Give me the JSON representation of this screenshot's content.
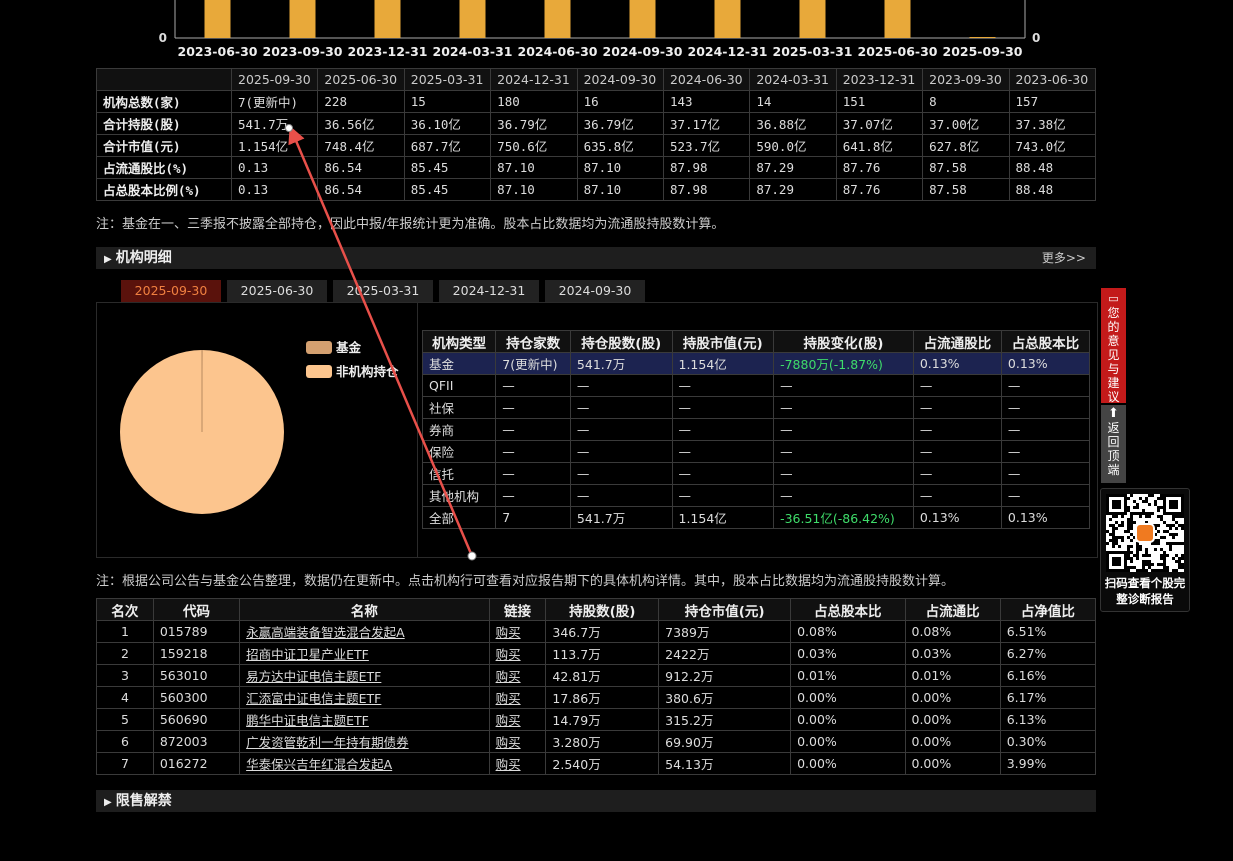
{
  "chart_data": {
    "type": "bar",
    "categories": [
      "2023-06-30",
      "2023-09-30",
      "2023-12-31",
      "2024-03-31",
      "2024-06-30",
      "2024-09-30",
      "2024-12-31",
      "2025-03-31",
      "2025-06-30",
      "2025-09-30"
    ],
    "y_left_min_label": "0",
    "y_right_min_label": "0",
    "bar_color": "#e8a93a"
  },
  "summary": {
    "headers": [
      "2025-09-30",
      "2025-06-30",
      "2025-03-31",
      "2024-12-31",
      "2024-09-30",
      "2024-06-30",
      "2024-03-31",
      "2023-12-31",
      "2023-09-30",
      "2023-06-30"
    ],
    "rows": [
      {
        "label": "机构总数(家)",
        "values": [
          "7(更新中)",
          "228",
          "15",
          "180",
          "16",
          "143",
          "14",
          "151",
          "8",
          "157"
        ]
      },
      {
        "label": "合计持股(股)",
        "values": [
          "541.7万",
          "36.56亿",
          "36.10亿",
          "36.79亿",
          "36.79亿",
          "37.17亿",
          "36.88亿",
          "37.07亿",
          "37.00亿",
          "37.38亿"
        ]
      },
      {
        "label": "合计市值(元)",
        "values": [
          "1.154亿",
          "748.4亿",
          "687.7亿",
          "750.6亿",
          "635.8亿",
          "523.7亿",
          "590.0亿",
          "641.8亿",
          "627.8亿",
          "743.0亿"
        ]
      },
      {
        "label": "占流通股比(%)",
        "values": [
          "0.13",
          "86.54",
          "85.45",
          "87.10",
          "87.10",
          "87.98",
          "87.29",
          "87.76",
          "87.58",
          "88.48"
        ]
      },
      {
        "label": "占总股本比例(%)",
        "values": [
          "0.13",
          "86.54",
          "85.45",
          "87.10",
          "87.10",
          "87.98",
          "87.29",
          "87.76",
          "87.58",
          "88.48"
        ]
      }
    ]
  },
  "note1": "注：基金在一、三季报不披露全部持仓，因此中报/年报统计更为准确。股本占比数据均为流通股持股数计算。",
  "section_detail": {
    "title": "机构明细",
    "more": "更多>>"
  },
  "tabs": [
    "2025-09-30",
    "2025-06-30",
    "2025-03-31",
    "2024-12-31",
    "2024-09-30"
  ],
  "pie": {
    "legend": [
      {
        "label": "基金",
        "color": "#d4a070"
      },
      {
        "label": "非机构持仓",
        "color": "#fcc58e"
      }
    ],
    "fund_share_pct": 0.13,
    "colors": {
      "fund": "#d4a070",
      "other": "#fcc58e"
    }
  },
  "inst_table": {
    "headers": [
      "机构类型",
      "持仓家数",
      "持仓股数(股)",
      "持股市值(元)",
      "持股变化(股)",
      "占流通股比",
      "占总股本比"
    ],
    "rows": [
      [
        "基金",
        "7(更新中)",
        "541.7万",
        "1.154亿",
        "-7880万(-1.87%)",
        "0.13%",
        "0.13%"
      ],
      [
        "QFII",
        "—",
        "—",
        "—",
        "—",
        "—",
        "—"
      ],
      [
        "社保",
        "—",
        "—",
        "—",
        "—",
        "—",
        "—"
      ],
      [
        "券商",
        "—",
        "—",
        "—",
        "—",
        "—",
        "—"
      ],
      [
        "保险",
        "—",
        "—",
        "—",
        "—",
        "—",
        "—"
      ],
      [
        "信托",
        "—",
        "—",
        "—",
        "—",
        "—",
        "—"
      ],
      [
        "其他机构",
        "—",
        "—",
        "—",
        "—",
        "—",
        "—"
      ],
      [
        "全部",
        "7",
        "541.7万",
        "1.154亿",
        "-36.51亿(-86.42%)",
        "0.13%",
        "0.13%"
      ]
    ]
  },
  "note2": "注：根据公司公告与基金公告整理，数据仍在更新中。点击机构行可查看对应报告期下的具体机构详情。其中，股本占比数据均为流通股持股数计算。",
  "rank_table": {
    "headers": [
      "名次",
      "代码",
      "名称",
      "链接",
      "持股数(股)",
      "持仓市值(元)",
      "占总股本比",
      "占流通比",
      "占净值比"
    ],
    "rows": [
      [
        "1",
        "015789",
        "永赢高端装备智选混合发起A",
        "购买",
        "346.7万",
        "7389万",
        "0.08%",
        "0.08%",
        "6.51%"
      ],
      [
        "2",
        "159218",
        "招商中证卫星产业ETF",
        "购买",
        "113.7万",
        "2422万",
        "0.03%",
        "0.03%",
        "6.27%"
      ],
      [
        "3",
        "563010",
        "易方达中证电信主题ETF",
        "购买",
        "42.81万",
        "912.2万",
        "0.01%",
        "0.01%",
        "6.16%"
      ],
      [
        "4",
        "560300",
        "汇添富中证电信主题ETF",
        "购买",
        "17.86万",
        "380.6万",
        "0.00%",
        "0.00%",
        "6.17%"
      ],
      [
        "5",
        "560690",
        "鹏华中证电信主题ETF",
        "购买",
        "14.79万",
        "315.2万",
        "0.00%",
        "0.00%",
        "6.13%"
      ],
      [
        "6",
        "872003",
        "广发资管乾利一年持有期债券",
        "购买",
        "3.280万",
        "69.90万",
        "0.00%",
        "0.00%",
        "0.30%"
      ],
      [
        "7",
        "016272",
        "华泰保兴吉年红混合发起A",
        "购买",
        "2.540万",
        "54.13万",
        "0.00%",
        "0.00%",
        "3.99%"
      ]
    ]
  },
  "section_restrict": {
    "title": "限售解禁"
  },
  "side": {
    "feedback": "您的意见与建议",
    "backtop": "返回顶端",
    "qr_text": "扫码查看个股完整诊断报告"
  },
  "colors": {
    "annotation_arrow": "#e8504a",
    "positive": "#3fdc6a",
    "accent_tab": "#f08040"
  }
}
